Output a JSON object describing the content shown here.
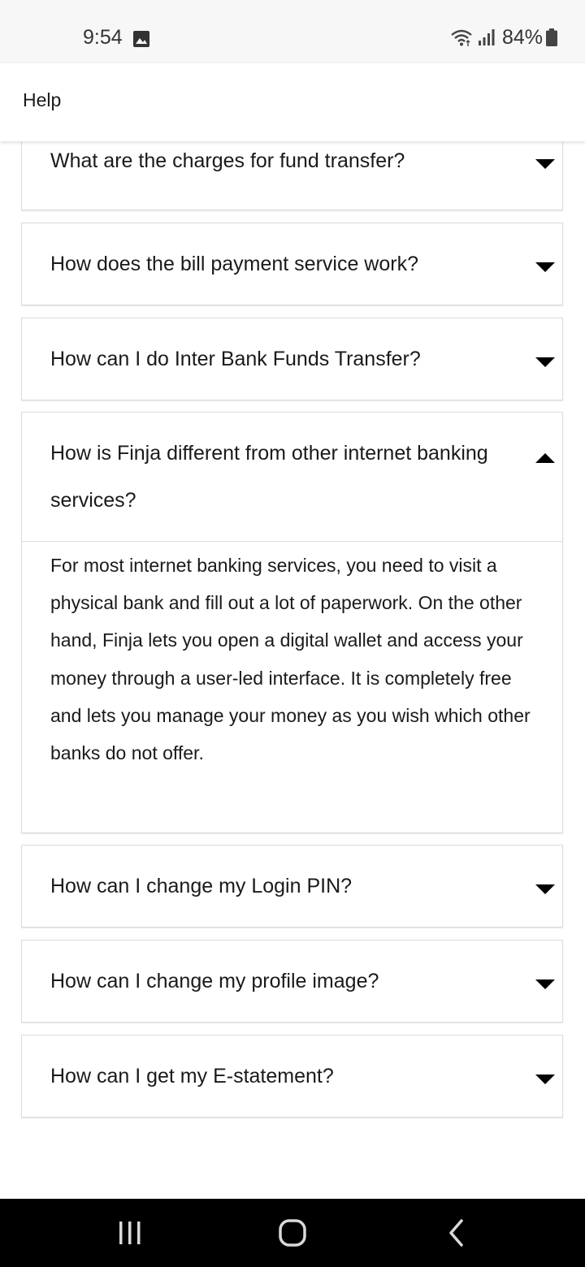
{
  "status_bar": {
    "time": "9:54",
    "battery_percent": "84%",
    "icons": [
      "gallery-icon",
      "wifi-icon",
      "signal-icon",
      "battery-icon"
    ]
  },
  "app_bar": {
    "title": "Help"
  },
  "faq": [
    {
      "question": "What are the charges for fund transfer?",
      "expanded": false
    },
    {
      "question": "How does the bill payment service work?",
      "expanded": false
    },
    {
      "question": "How can I do Inter Bank Funds Transfer?",
      "expanded": false
    },
    {
      "question": "How is Finja different from other internet banking services?",
      "expanded": true,
      "answer": "For most internet banking services, you need to visit a physical bank and fill out a lot of paperwork. On the other hand, Finja lets you open a digital wallet and access your money through a user-led interface. It is completely free and lets you manage your money as you wish which other banks do not offer."
    },
    {
      "question": "How can I change my Login PIN?",
      "expanded": false
    },
    {
      "question": "How can I change my profile image?",
      "expanded": false
    },
    {
      "question": "How can I get my E-statement?",
      "expanded": false
    }
  ],
  "nav_bar": {
    "icons": [
      "recent-apps-icon",
      "home-icon",
      "back-icon"
    ]
  },
  "colors": {
    "status_bar_bg": "#f7f7f7",
    "card_border": "#dcdcdc",
    "nav_bar_bg": "#000000"
  }
}
